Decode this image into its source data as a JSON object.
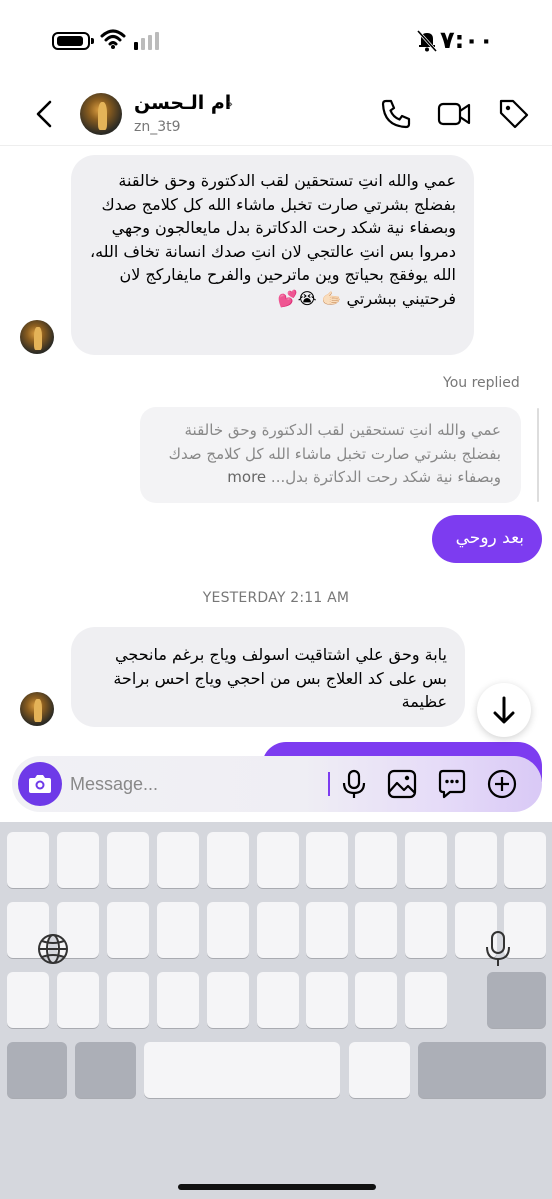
{
  "status_bar": {
    "time": "٧:٠٠"
  },
  "header": {
    "name": "ام الـحسن",
    "username": "zn_3t9",
    "name_chevron": "›"
  },
  "messages": {
    "incoming_1": "عمي والله انتِ  تستحقين لقب الدكتورة وحق خالقنة بفضلج بشرتي صارت تخبل ماشاء الله كل كلامج صدك وبصفاء نية شكد رحت الدكاترة بدل مايعالجون وجهي دمروا بس انتِ عالتجي لان انتِ صدك انسانة تخاف الله، الله يوفقج بحياتج وين ماترحين والفرح مايفاركج لان فرحتيني ببشرتي 🫱🏻 😭💕",
    "replied_label": "You replied",
    "quoted_text": "عمي والله انتِ  تستحقين لقب الدكتورة وحق خالقنة بفضلج بشرتي صارت تخبل ماشاء الله كل كلامج صدك وبصفاء نية شكد رحت الدكاترة بدل...",
    "quoted_more": "more",
    "outgoing_1": "بعد روحي",
    "date_separator": "YESTERDAY 2:11 AM",
    "incoming_2": "يابة وحق علي اشتاقيت اسولف وياج برغم مانحجي بس على كد العلاج بس من احجي وياج احس براحة عظيمة"
  },
  "composer": {
    "placeholder": "Message..."
  },
  "colors": {
    "accent": "#7d3cf0",
    "incoming_bubble": "#efeff2",
    "keyboard_bg": "#d5d7dd"
  },
  "icons": [
    "battery-icon",
    "wifi-icon",
    "signal-icon",
    "silent-bell-icon",
    "back-chevron-icon",
    "phone-icon",
    "video-camera-icon",
    "tag-icon",
    "arrow-down-icon",
    "camera-icon",
    "microphone-icon",
    "gallery-icon",
    "sticker-icon",
    "plus-icon",
    "globe-icon"
  ]
}
